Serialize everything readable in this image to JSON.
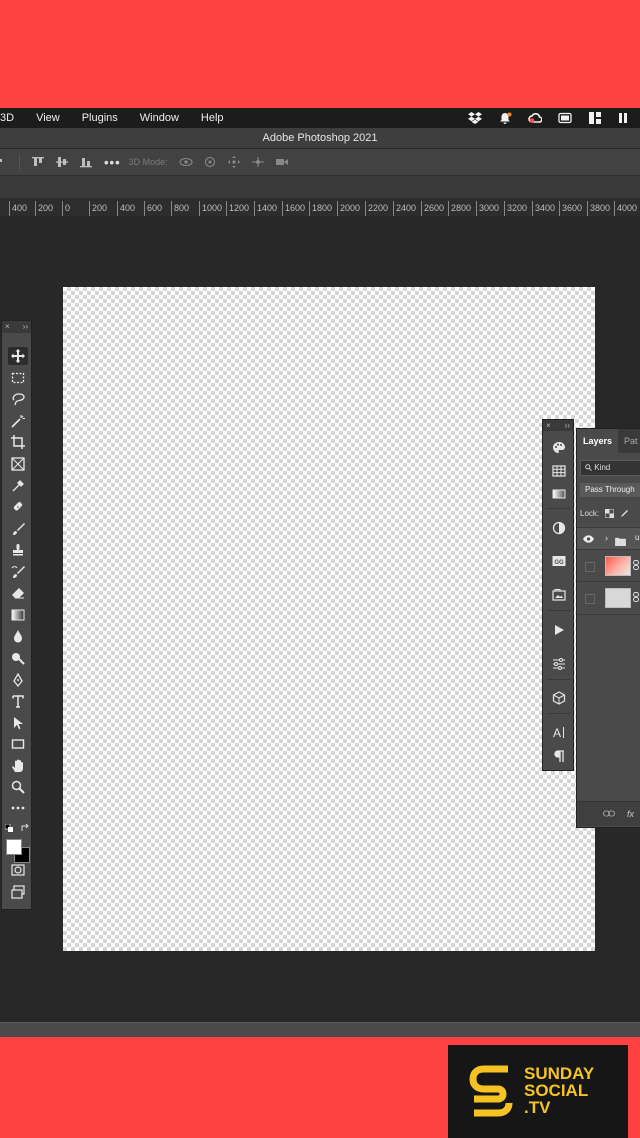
{
  "menubar": {
    "items": [
      "3D",
      "View",
      "Plugins",
      "Window",
      "Help"
    ],
    "tray_icons": [
      "dropbox-icon",
      "notification-icon",
      "creative-cloud-icon",
      "display-icon",
      "control-center-icon",
      "clock-icon"
    ]
  },
  "window": {
    "title": "Adobe Photoshop 2021"
  },
  "options_bar": {
    "more": "•••",
    "mode_label": "3D Mode:"
  },
  "ruler": {
    "labels": [
      "400",
      "200",
      "0",
      "200",
      "400",
      "600",
      "800",
      "1000",
      "1200",
      "1400",
      "1600",
      "1800",
      "2000",
      "2200",
      "2400",
      "2600",
      "2800",
      "3000",
      "3200",
      "3400",
      "3600",
      "3800",
      "4000"
    ]
  },
  "tools_panel": {
    "close": "×",
    "collapse": "››",
    "tools": [
      "move-tool",
      "marquee-tool",
      "lasso-tool",
      "magic-wand-tool",
      "crop-tool",
      "frame-tool",
      "eyedropper-tool",
      "healing-brush-tool",
      "brush-tool",
      "clone-stamp-tool",
      "history-brush-tool",
      "eraser-tool",
      "gradient-tool",
      "blur-tool",
      "dodge-tool",
      "pen-tool",
      "type-tool",
      "path-selection-tool",
      "rectangle-tool",
      "hand-tool",
      "zoom-tool",
      "edit-toolbar"
    ],
    "colors": {
      "foreground": "#ffffff",
      "background": "#000000"
    }
  },
  "dock": {
    "close": "×",
    "collapse": "››"
  },
  "layers_panel": {
    "tabs": [
      "Layers",
      "Pat"
    ],
    "search_placeholder": "Kind",
    "blend_mode": "Pass Through",
    "lock_label": "Lock:",
    "group_name": "u",
    "footer_fx": "fx"
  },
  "brand": {
    "line1": "SUNDAY",
    "line2": "SOCIAL",
    "line3": ".TV",
    "color": "#f5c423"
  }
}
